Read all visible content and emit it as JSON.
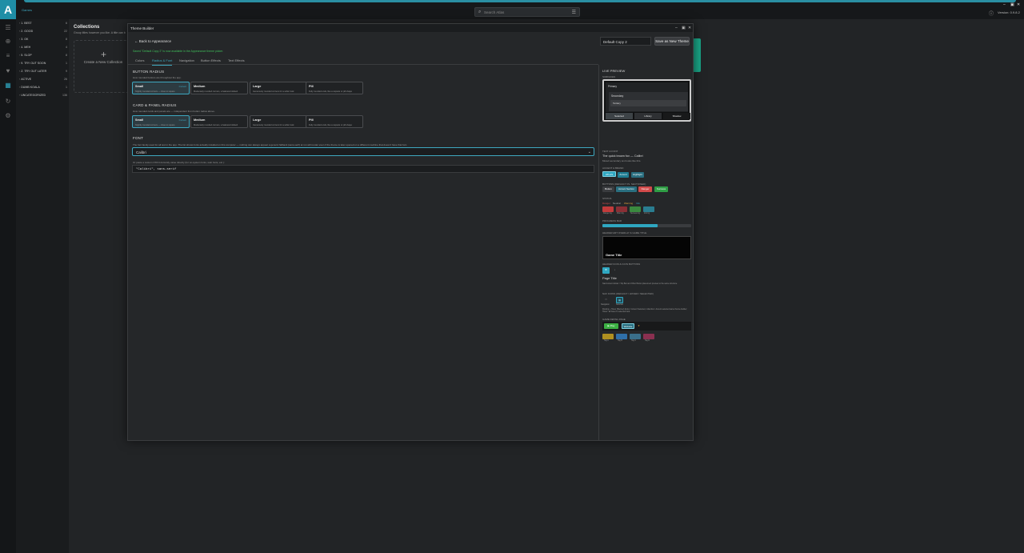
{
  "topbar": {
    "breadcrumb": "Games",
    "search_placeholder": "Search Atlas",
    "version": "Version: 0.9.8.2"
  },
  "sidebar": {
    "items": [
      {
        "label": "1. BEST",
        "count": "6"
      },
      {
        "label": "2. GOOD",
        "count": "22"
      },
      {
        "label": "3. OK",
        "count": "8"
      },
      {
        "label": "4. MEH",
        "count": "4"
      },
      {
        "label": "5. SLOP",
        "count": "8"
      },
      {
        "label": "9. TRY OUT SOON",
        "count": "1"
      },
      {
        "label": "Z. TRY OUT LATER",
        "count": "9"
      },
      {
        "label": "ACTIVE",
        "count": "26"
      },
      {
        "label": "DUMB KOALA",
        "count": "1"
      },
      {
        "label": "UNCATEGORIZED",
        "count": "136"
      }
    ]
  },
  "main": {
    "title": "Collections",
    "subtitle": "Group titles however you like. A title can b",
    "new_collection": "Create a New Collection"
  },
  "theme_builder": {
    "window_title": "Theme Builder",
    "back_label": "Back to Appearance",
    "theme_name": "Default Copy 2",
    "save_label": "Save as New Theme",
    "saved_message": "Saved \"Default Copy 2\" is now available in the Appearance theme picker.",
    "tabs": [
      "Colors",
      "Radius & Font",
      "Navigation",
      "Button Effects",
      "Text Effects"
    ],
    "button_radius": {
      "title": "BUTTON RADIUS",
      "desc": "How rounded buttons are throughout the app.",
      "options": [
        {
          "name": "Small",
          "desc": "Slightly rounded corners — close to square",
          "current": "Current"
        },
        {
          "name": "Medium",
          "desc": "Moderately rounded corners, a balanced default",
          "current": ""
        },
        {
          "name": "Large",
          "desc": "Generously rounded corners for a softer look",
          "current": ""
        },
        {
          "name": "Pill",
          "desc": "Fully rounded ends, like a capsule or pill shape",
          "current": ""
        }
      ]
    },
    "card_radius": {
      "title": "CARD & PANEL RADIUS",
      "desc": "How rounded cards and panels are — independent from button radius above.",
      "options": [
        {
          "name": "Small",
          "desc": "Slightly rounded corners — close to square",
          "current": "Current"
        },
        {
          "name": "Medium",
          "desc": "Moderately rounded corners, a balanced default",
          "current": ""
        },
        {
          "name": "Large",
          "desc": "Generously rounded corners for a softer look",
          "current": ""
        },
        {
          "name": "Pill",
          "desc": "Fully rounded ends, like a capsule or pill shape",
          "current": ""
        }
      ]
    },
    "font": {
      "title": "FONT",
      "desc": "The font family used for all text in the app. The list shows fonts actually installed on this computer — nothing can always appear a generic fallback (sans-serif) at run will render even if the theme is later opened on a different machine that doesn't have that font.",
      "selected": "Calibri",
      "custom_desc": "Or paste a custom CSS font-family value directly (for on-system fonts, web fonts, etc.):",
      "custom_value": "\"Calibri\", sans-serif"
    }
  },
  "preview": {
    "title": "LIVE PREVIEW",
    "surfaces_label": "SURFACES",
    "primary": "Primary",
    "secondary": "Secondary",
    "tertiary": "Tertiary",
    "btn_selected": "Selected",
    "btn_library": "Library",
    "btn_shadow": "Shadow",
    "text_label": "TEXT & FONT",
    "sample_text": "The quick brown fox — Calibri",
    "muted_text": "Muted secondary text looks like this.",
    "accent_label": "ACCENT & BRAND",
    "accent_chips": [
      "ATLAS",
      "Accent",
      "Highlight"
    ],
    "buttons_label": "BUTTONS (DEFAULT VS. SECTIONED)",
    "button_chips": [
      "Button",
      "Accent Section",
      "Danger",
      "Success"
    ],
    "status_label": "STATUS",
    "status_words": [
      "Danger",
      "Neutral",
      "Warning",
      "Info"
    ],
    "status_swatches": [
      "Danger bg",
      "Warn bg",
      "Success bg",
      "Info bg"
    ],
    "progress_label": "PROGRESS BAR",
    "progress_fraction": 0.62,
    "hero_label": "HEADER ART OVERLAY & GAME TITLE",
    "hero_title": "Game Title",
    "header_label": "HEADER ICON & ICON BUTTONS",
    "page_title": "Page Title",
    "page_desc": "Nav/content divider / Top Bar and Other Button placement preview to the same structure.",
    "nav_label": "NAV ICONS (DEFAULT / HOVER / SELECTED)",
    "nav_names": [
      "Navigation",
      "Selected"
    ],
    "nav_desc": "Routing + Hover (Banner) Extra = Accent Selected, collection / Accent selected same theme-builder; Hover: all have it's selected look.",
    "game_label": "GAME DETAIL PAGE",
    "game_buttons": [
      "Play",
      "Website"
    ],
    "tags": [
      "Tag A",
      "Tag B",
      "Tag C",
      "Tag D"
    ],
    "colors": {
      "accent": "#2fa7c1",
      "danger": "#d24a4a",
      "success": "#3cb043",
      "warning": "#e0a03a"
    }
  }
}
